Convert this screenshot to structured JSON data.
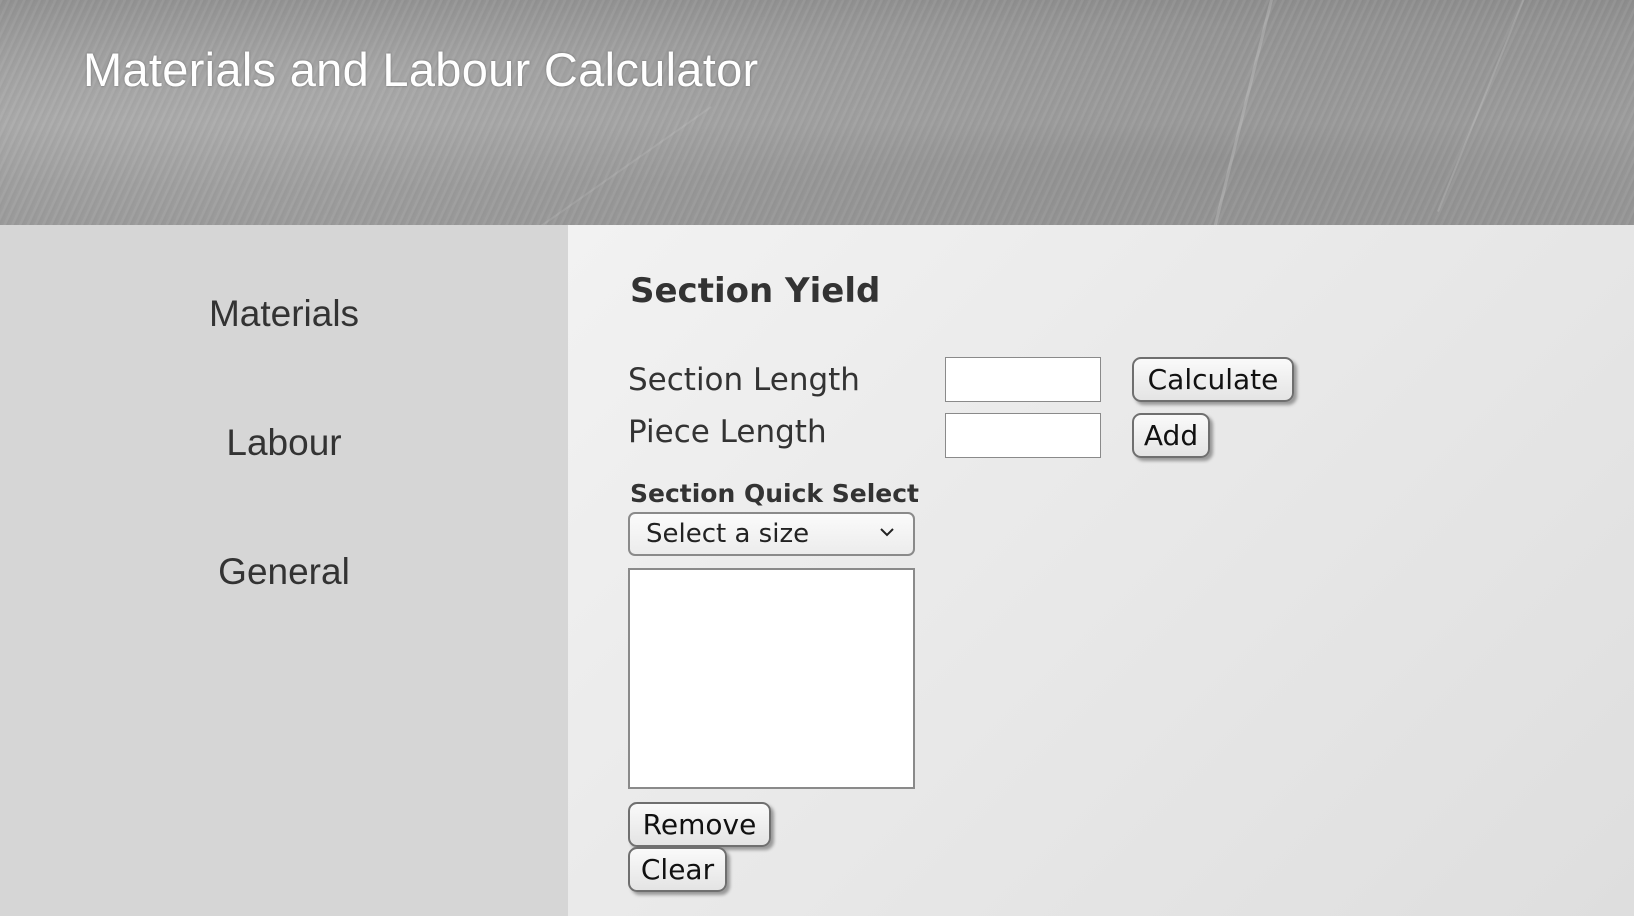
{
  "header": {
    "title": "Materials and Labour Calculator"
  },
  "sidebar": {
    "items": [
      {
        "label": "Materials"
      },
      {
        "label": "Labour"
      },
      {
        "label": "General"
      }
    ]
  },
  "main": {
    "section_title": "Section Yield",
    "section_length": {
      "label": "Section Length",
      "value": ""
    },
    "piece_length": {
      "label": "Piece Length",
      "value": ""
    },
    "buttons": {
      "calculate": "Calculate",
      "add": "Add",
      "remove": "Remove",
      "clear": "Clear"
    },
    "quick_select": {
      "label": "Section Quick Select",
      "selected": "Select a size"
    },
    "list_items": []
  },
  "icons": {
    "dropdown": "chevron-down-icon"
  }
}
